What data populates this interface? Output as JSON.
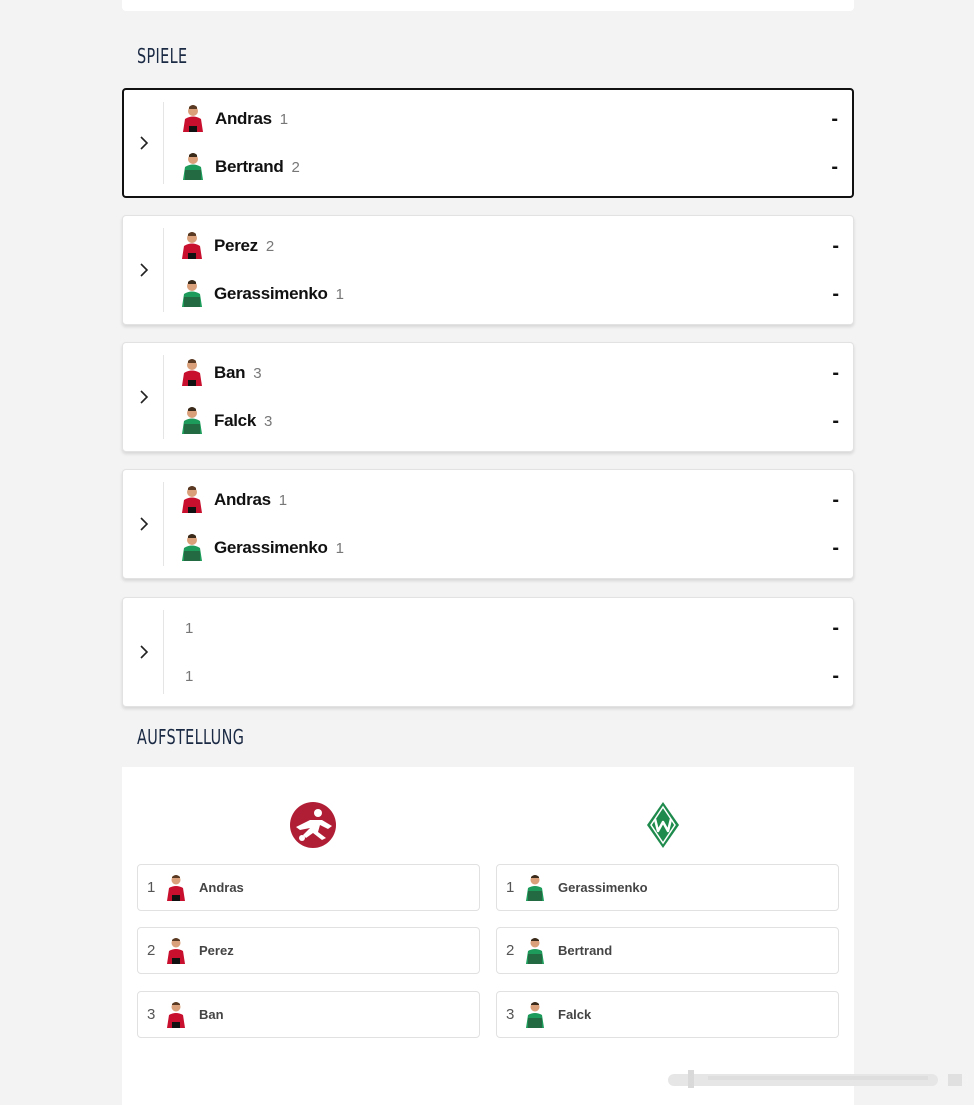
{
  "sections": {
    "spiele": "SPIELE",
    "aufstellung": "AUFSTELLUNG"
  },
  "colors": {
    "home_kit": "#c8102e",
    "away_kit": "#1d9b5a",
    "home_logo": "#b01e36",
    "away_logo": "#1e8a4c",
    "title": "#1b2a44"
  },
  "icons": {
    "expand": "chevron-right-icon",
    "home_avatar": "home-player-avatar",
    "away_avatar": "away-player-avatar",
    "home_logo": "home-club-logo",
    "away_logo": "werder-bremen-logo"
  },
  "matches": [
    {
      "home": {
        "name": "Andras",
        "num": "1",
        "score": "-"
      },
      "away": {
        "name": "Bertrand",
        "num": "2",
        "score": "-"
      }
    },
    {
      "home": {
        "name": "Perez",
        "num": "2",
        "score": "-"
      },
      "away": {
        "name": "Gerassimenko",
        "num": "1",
        "score": "-"
      }
    },
    {
      "home": {
        "name": "Ban",
        "num": "3",
        "score": "-"
      },
      "away": {
        "name": "Falck",
        "num": "3",
        "score": "-"
      }
    },
    {
      "home": {
        "name": "Andras",
        "num": "1",
        "score": "-"
      },
      "away": {
        "name": "Gerassimenko",
        "num": "1",
        "score": "-"
      }
    },
    {
      "home": {
        "name": "",
        "num": "1",
        "score": "-"
      },
      "away": {
        "name": "",
        "num": "1",
        "score": "-"
      }
    }
  ],
  "lineup": {
    "home": [
      {
        "num": "1",
        "name": "Andras"
      },
      {
        "num": "2",
        "name": "Perez"
      },
      {
        "num": "3",
        "name": "Ban"
      }
    ],
    "away": [
      {
        "num": "1",
        "name": "Gerassimenko"
      },
      {
        "num": "2",
        "name": "Bertrand"
      },
      {
        "num": "3",
        "name": "Falck"
      }
    ]
  }
}
